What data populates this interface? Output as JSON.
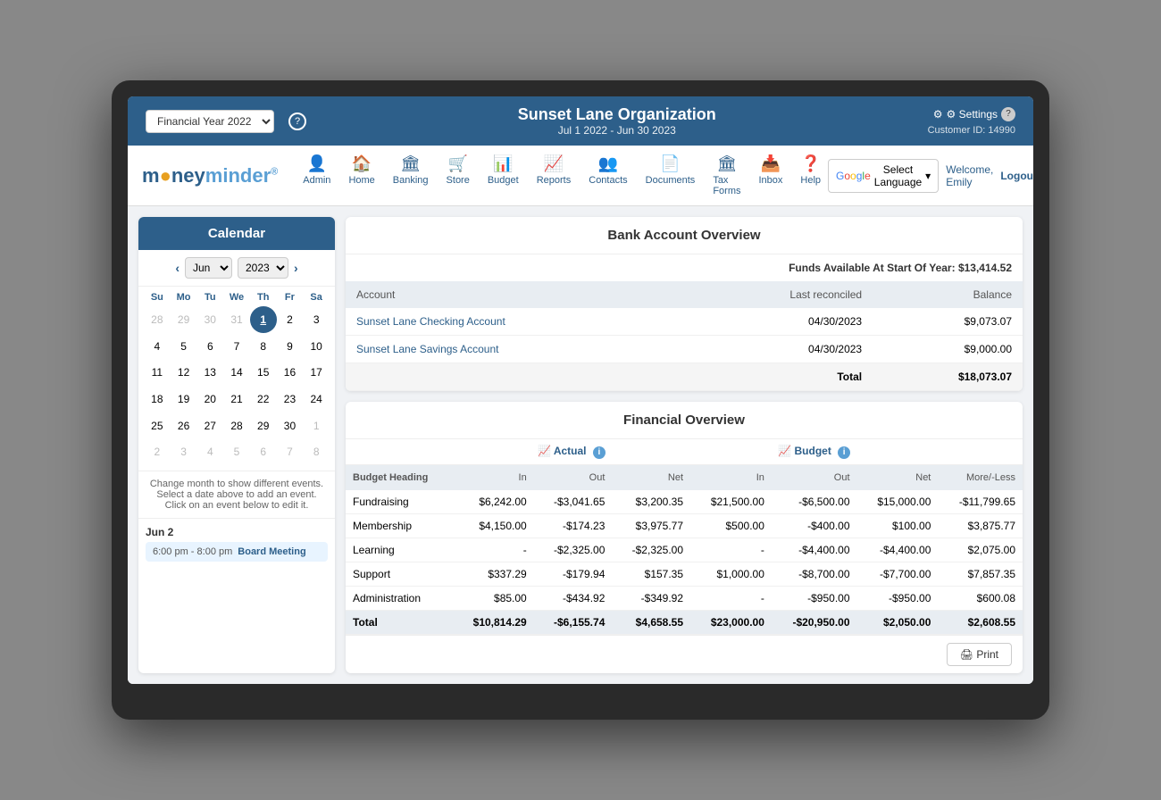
{
  "topBar": {
    "fiscalYearLabel": "Financial Year 2022",
    "orgName": "Sunset Lane Organization",
    "dateRange": "Jul 1 2022 - Jun 30 2023",
    "settingsLabel": "⚙ Settings",
    "helpLabel": "?",
    "customerIdLabel": "Customer ID: 14990"
  },
  "nav": {
    "logoMoney": "m",
    "logoFull": "moneyminder®",
    "items": [
      {
        "id": "admin",
        "label": "Admin",
        "icon": "👤"
      },
      {
        "id": "home",
        "label": "Home",
        "icon": "🏠"
      },
      {
        "id": "banking",
        "label": "Banking",
        "icon": "🏛"
      },
      {
        "id": "store",
        "label": "Store",
        "icon": "🛒"
      },
      {
        "id": "budget",
        "label": "Budget",
        "icon": "📊"
      },
      {
        "id": "reports",
        "label": "Reports",
        "icon": "📈"
      },
      {
        "id": "contacts",
        "label": "Contacts",
        "icon": "👥"
      },
      {
        "id": "documents",
        "label": "Documents",
        "icon": "📄"
      },
      {
        "id": "taxforms",
        "label": "Tax Forms",
        "icon": "🏛"
      },
      {
        "id": "inbox",
        "label": "Inbox",
        "icon": "📥"
      },
      {
        "id": "help",
        "label": "Help",
        "icon": "❓"
      }
    ],
    "selectLanguage": "Select Language",
    "welcomeText": "Welcome, Emily",
    "logoutLabel": "Logout"
  },
  "calendar": {
    "title": "Calendar",
    "month": "Jun",
    "year": "2023",
    "dayHeaders": [
      "Su",
      "Mo",
      "Tu",
      "We",
      "Th",
      "Fr",
      "Sa"
    ],
    "weeks": [
      [
        {
          "day": "28",
          "type": "other"
        },
        {
          "day": "29",
          "type": "other"
        },
        {
          "day": "30",
          "type": "other"
        },
        {
          "day": "31",
          "type": "other"
        },
        {
          "day": "1",
          "type": "today"
        },
        {
          "day": "2",
          "type": "normal"
        },
        {
          "day": "3",
          "type": "normal"
        }
      ],
      [
        {
          "day": "4",
          "type": "normal"
        },
        {
          "day": "5",
          "type": "normal"
        },
        {
          "day": "6",
          "type": "normal"
        },
        {
          "day": "7",
          "type": "normal"
        },
        {
          "day": "8",
          "type": "normal"
        },
        {
          "day": "9",
          "type": "normal"
        },
        {
          "day": "10",
          "type": "normal"
        }
      ],
      [
        {
          "day": "11",
          "type": "normal"
        },
        {
          "day": "12",
          "type": "normal"
        },
        {
          "day": "13",
          "type": "normal"
        },
        {
          "day": "14",
          "type": "normal"
        },
        {
          "day": "15",
          "type": "normal"
        },
        {
          "day": "16",
          "type": "normal"
        },
        {
          "day": "17",
          "type": "normal"
        }
      ],
      [
        {
          "day": "18",
          "type": "normal"
        },
        {
          "day": "19",
          "type": "normal"
        },
        {
          "day": "20",
          "type": "normal"
        },
        {
          "day": "21",
          "type": "normal"
        },
        {
          "day": "22",
          "type": "normal"
        },
        {
          "day": "23",
          "type": "normal"
        },
        {
          "day": "24",
          "type": "normal"
        }
      ],
      [
        {
          "day": "25",
          "type": "normal"
        },
        {
          "day": "26",
          "type": "normal"
        },
        {
          "day": "27",
          "type": "normal"
        },
        {
          "day": "28",
          "type": "normal"
        },
        {
          "day": "29",
          "type": "normal"
        },
        {
          "day": "30",
          "type": "normal"
        },
        {
          "day": "1",
          "type": "other"
        }
      ],
      [
        {
          "day": "2",
          "type": "other"
        },
        {
          "day": "3",
          "type": "other"
        },
        {
          "day": "4",
          "type": "other"
        },
        {
          "day": "5",
          "type": "other"
        },
        {
          "day": "6",
          "type": "other"
        },
        {
          "day": "7",
          "type": "other"
        },
        {
          "day": "8",
          "type": "other"
        }
      ]
    ],
    "hint": "Change month to show different events. Select a date above to add an event. Click on an event below to edit it.",
    "eventDateLabel": "Jun 2",
    "event": {
      "time": "6:00 pm - 8:00 pm",
      "name": "Board Meeting"
    }
  },
  "bankOverview": {
    "title": "Bank Account Overview",
    "fundsLabel": "Funds Available At Start Of Year:",
    "fundsValue": "$13,414.52",
    "columns": [
      "Account",
      "Last reconciled",
      "Balance"
    ],
    "rows": [
      {
        "account": "Sunset Lane Checking Account",
        "lastReconciled": "04/30/2023",
        "balance": "$9,073.07"
      },
      {
        "account": "Sunset Lane Savings Account",
        "lastReconciled": "04/30/2023",
        "balance": "$9,000.00"
      }
    ],
    "totalLabel": "Total",
    "totalValue": "$18,073.07"
  },
  "financialOverview": {
    "title": "Financial Overview",
    "actualLabel": "Actual",
    "budgetLabel": "Budget",
    "columns": {
      "budgetHeading": "Budget Heading",
      "actualIn": "In",
      "actualOut": "Out",
      "actualNet": "Net",
      "budgetIn": "In",
      "budgetOut": "Out",
      "budgetNet": "Net",
      "moreLess": "More/-Less"
    },
    "rows": [
      {
        "heading": "Fundraising",
        "aIn": "$6,242.00",
        "aOut": "-$3,041.65",
        "aNet": "$3,200.35",
        "bIn": "$21,500.00",
        "bOut": "-$6,500.00",
        "bNet": "$15,000.00",
        "moreLess": "-$11,799.65"
      },
      {
        "heading": "Membership",
        "aIn": "$4,150.00",
        "aOut": "-$174.23",
        "aNet": "$3,975.77",
        "bIn": "$500.00",
        "bOut": "-$400.00",
        "bNet": "$100.00",
        "moreLess": "$3,875.77"
      },
      {
        "heading": "Learning",
        "aIn": "-",
        "aOut": "-$2,325.00",
        "aNet": "-$2,325.00",
        "bIn": "-",
        "bOut": "-$4,400.00",
        "bNet": "-$4,400.00",
        "moreLess": "$2,075.00"
      },
      {
        "heading": "Support",
        "aIn": "$337.29",
        "aOut": "-$179.94",
        "aNet": "$157.35",
        "bIn": "$1,000.00",
        "bOut": "-$8,700.00",
        "bNet": "-$7,700.00",
        "moreLess": "$7,857.35"
      },
      {
        "heading": "Administration",
        "aIn": "$85.00",
        "aOut": "-$434.92",
        "aNet": "-$349.92",
        "bIn": "-",
        "bOut": "-$950.00",
        "bNet": "-$950.00",
        "moreLess": "$600.08"
      }
    ],
    "total": {
      "heading": "Total",
      "aIn": "$10,814.29",
      "aOut": "-$6,155.74",
      "aNet": "$4,658.55",
      "bIn": "$23,000.00",
      "bOut": "-$20,950.00",
      "bNet": "$2,050.00",
      "moreLess": "$2,608.55"
    },
    "printLabel": "🖨 Print"
  }
}
